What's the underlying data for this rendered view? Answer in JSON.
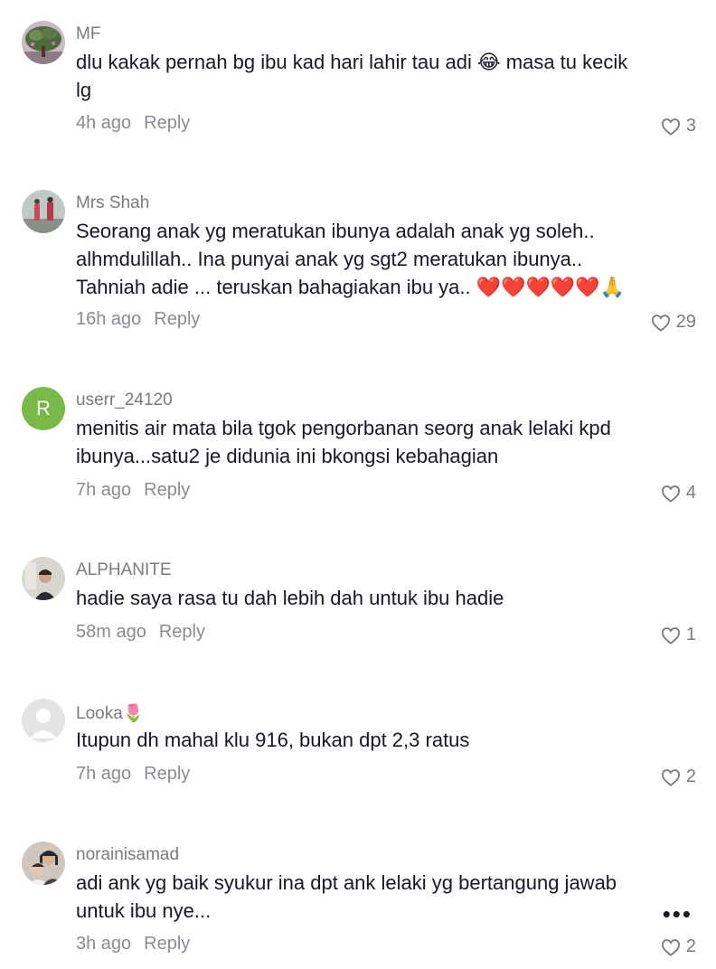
{
  "comments": [
    {
      "username": "MF",
      "text": "dlu kakak pernah bg ibu kad hari lahir tau adi 😂 masa tu kecik lg",
      "time": "4h ago",
      "reply_label": "Reply",
      "likes": "3",
      "avatar": "tree-photo"
    },
    {
      "username": "Mrs Shah",
      "text": "Seorang anak yg meratukan ibunya adalah anak yg soleh.. alhmdulillah.. Ina punyai anak yg sgt2 meratukan ibunya.. Tahniah adie ... teruskan bahagiakan ibu ya.. ❤️❤️❤️❤️❤️🙏",
      "time": "16h ago",
      "reply_label": "Reply",
      "likes": "29",
      "avatar": "people-photo"
    },
    {
      "username": "userr_24120",
      "text": "menitis air mata bila tgok pengorbanan seorg anak lelaki kpd ibunya...satu2 je didunia ini bkongsi kebahagian",
      "time": "7h ago",
      "reply_label": "Reply",
      "likes": "4",
      "avatar": "letter-R",
      "avatar_letter": "R",
      "avatar_color": "#78b948"
    },
    {
      "username": "ALPHANITE",
      "text": "hadie saya rasa tu dah lebih dah untuk ibu hadie",
      "time": "58m ago",
      "reply_label": "Reply",
      "likes": "1",
      "avatar": "person-photo"
    },
    {
      "username": "Looka🌷",
      "text": "Itupun dh mahal klu 916, bukan dpt 2,3 ratus",
      "time": "7h ago",
      "reply_label": "Reply",
      "likes": "2",
      "avatar": "default-user"
    },
    {
      "username": "norainisamad",
      "text": "adi ank yg baik syukur ina dpt ank lelaki yg bertangung jawab untuk ibu nye...",
      "time": "3h ago",
      "reply_label": "Reply",
      "likes": "2",
      "avatar": "family-photo"
    }
  ],
  "more_label": "•••",
  "colors": {
    "text": "#161823",
    "muted": "#8a8b91",
    "avatar_green": "#78b948"
  }
}
